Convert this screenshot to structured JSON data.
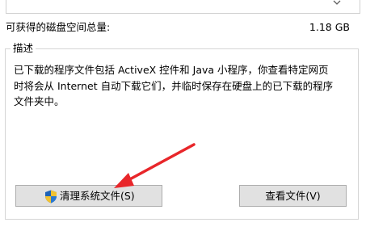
{
  "space": {
    "label": "可获得的磁盘空间总量:",
    "value": "1.18 GB"
  },
  "description": {
    "legend": "描述",
    "text": "已下载的程序文件包括 ActiveX 控件和 Java 小程序，你查看特定网页\n时将会从 Internet 自动下载它们，并临时保存在硬盘上的已下载的程序\n文件夹中。"
  },
  "buttons": {
    "cleanup_system_files": "清理系统文件(S)",
    "view_files": "查看文件(V)"
  },
  "colors": {
    "annotation_arrow": "#e8262a",
    "button_face": "#e1e1e1",
    "button_border": "#adadad",
    "group_border": "#d5d5d5"
  },
  "icons": {
    "cleanup_button_icon": "uac-shield-icon",
    "scroll_arrow": "chevron-down-icon"
  }
}
